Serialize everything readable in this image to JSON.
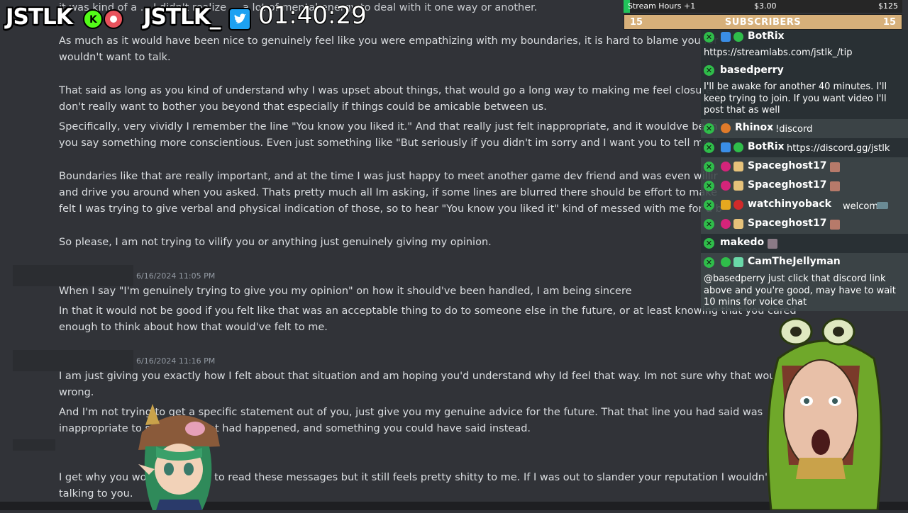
{
  "stream": {
    "logo_text_1": "JSTLK",
    "logo_text_2": "JSTLK_",
    "timer": "01:40:29",
    "goal": {
      "label": "Stream Hours +1",
      "current": "$3.00",
      "target": "$125",
      "progress_fraction": 0.024
    },
    "subscribers": {
      "label": "SUBSCRIBERS",
      "left_count": "15",
      "right_count": "15"
    }
  },
  "messages": {
    "group1": [
      "it was kind of a ... I didn't realize ... a lot of mental energy to deal with it one way or another.",
      "As much as it would have been nice to genuinely feel like you were empathizing with my boundaries, it is hard to blame you for",
      "wouldn't want to talk.",
      "That said as long as you kind of understand why I was upset about things, that would go a long way to making me feel closure o",
      "don't really want to bother you beyond that especially if things could be amicable between us.",
      "Specifically, very vividly I remember the line \"You know you liked it.\" And that really just felt inappropriate, and it wouldve been",
      "you say something more conscientious. Even just something like \"But seriously if you didn't im sorry and I want you to tell me.\"",
      "Boundaries like that are really important, and at the time I was just happy to meet another game dev friend and was even willir",
      "and drive you around when you asked. Thats pretty much all Im asking, if some lines are blurred there should be effort to make",
      "felt I was trying to give verbal and physical indication of those, so to hear \"You know you liked it\" kind of messed with me for a b",
      "So please, I am not trying to vilify you or anything just genuinely giving my opinion."
    ],
    "group2": {
      "timestamp": "6/16/2024 11:05 PM",
      "lines": [
        "When I say \"I'm genuinely trying to give you my opinion\" on how it should've been handled, I am being sincere",
        "In that it would not be good if you felt like that was an acceptable thing to do to someone else in the future, or at least knowing that you cared",
        "enough to think about how that would've felt to me."
      ]
    },
    "group3": {
      "timestamp": "6/16/2024 11:16 PM",
      "lines": [
        "I am just giving you exactly how I felt about that situation and am hoping you'd understand why Id feel that way. Im not sure why that would b",
        "wrong.",
        "And I'm not trying to get a specific statement out of you, just give you my genuine advice for the future. That that line you had said was",
        "inappropriate to say after what had happened, and something you could have said instead.",
        "I get why you would not want to read these messages but it still feels pretty shitty to me. If I was out to slander your reputation I wouldn't have even tri",
        "talking to you."
      ]
    }
  },
  "chat": [
    {
      "user": "BotRix",
      "text": "https://streamlabs.com/jstlk_/tip",
      "color": "#ffffff"
    },
    {
      "user": "basedperry",
      "text": "I'll be awake for another 40 minutes. I'll keep trying to join. If you want video I'll post that as well"
    },
    {
      "user": "Rhinox",
      "text": "!discord"
    },
    {
      "user": "BotRix",
      "text": "https://discord.gg/jstlk"
    },
    {
      "user": "Spaceghost17",
      "text": ""
    },
    {
      "user": "Spaceghost17",
      "text": ""
    },
    {
      "user": "watchinyoback",
      "text": "welcome"
    },
    {
      "user": "Spaceghost17",
      "text": ""
    },
    {
      "user": "makedo",
      "text": ""
    },
    {
      "user": "CamTheJellyman",
      "text": "@basedperry just click that discord link above and you're good, may have to wait 10 mins for voice chat"
    }
  ],
  "colors": {
    "discord_bg": "#313338",
    "chat_check": "#2fbd4a",
    "goal_fill": "#21c35a",
    "subscriber_bar": "#d7b07a",
    "twitter_blue": "#1da1f2",
    "kick_green": "#53fc18"
  },
  "icons": {
    "chat_badge": "x-circle-icon",
    "twitter": "twitter-icon",
    "kick": "kick-icon",
    "record": "record-icon"
  }
}
